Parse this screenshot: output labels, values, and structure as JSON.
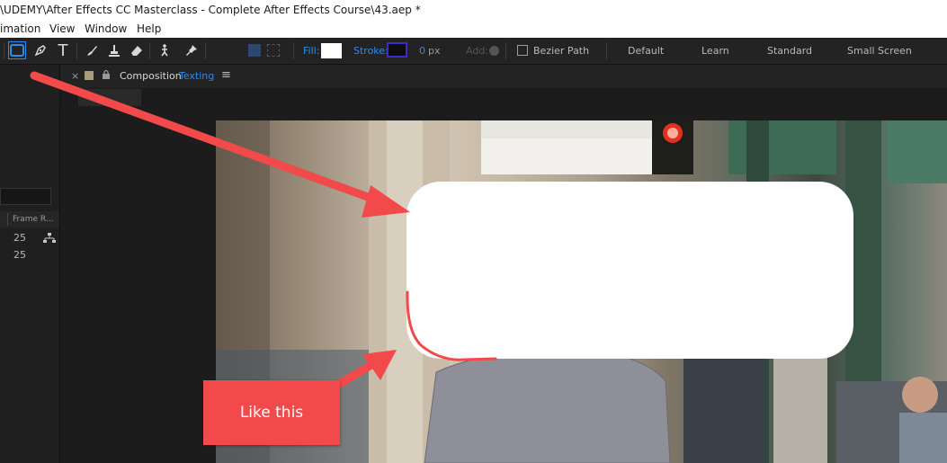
{
  "window": {
    "title": "\\UDEMY\\After Effects CC Masterclass - Complete After Effects Course\\43.aep *"
  },
  "menu": {
    "items": [
      "imation",
      "View",
      "Window",
      "Help"
    ]
  },
  "toolbar": {
    "fill_label": "Fill:",
    "stroke_label": "Stroke:",
    "stroke_width": "0",
    "stroke_unit": "px",
    "add_label": "Add:",
    "bezier_label": "Bezier Path",
    "workspaces": [
      "Default",
      "Learn",
      "Standard",
      "Small Screen"
    ],
    "accent_color": "#2d8ceb"
  },
  "project_panel": {
    "column_header": "Frame R...",
    "rows": [
      {
        "value": "25"
      },
      {
        "value": "25"
      }
    ]
  },
  "composition": {
    "panel_label": "Composition",
    "comp_name": "Texting"
  },
  "annotation": {
    "callout_text": "Like this",
    "arrow_color": "#f2494b"
  }
}
